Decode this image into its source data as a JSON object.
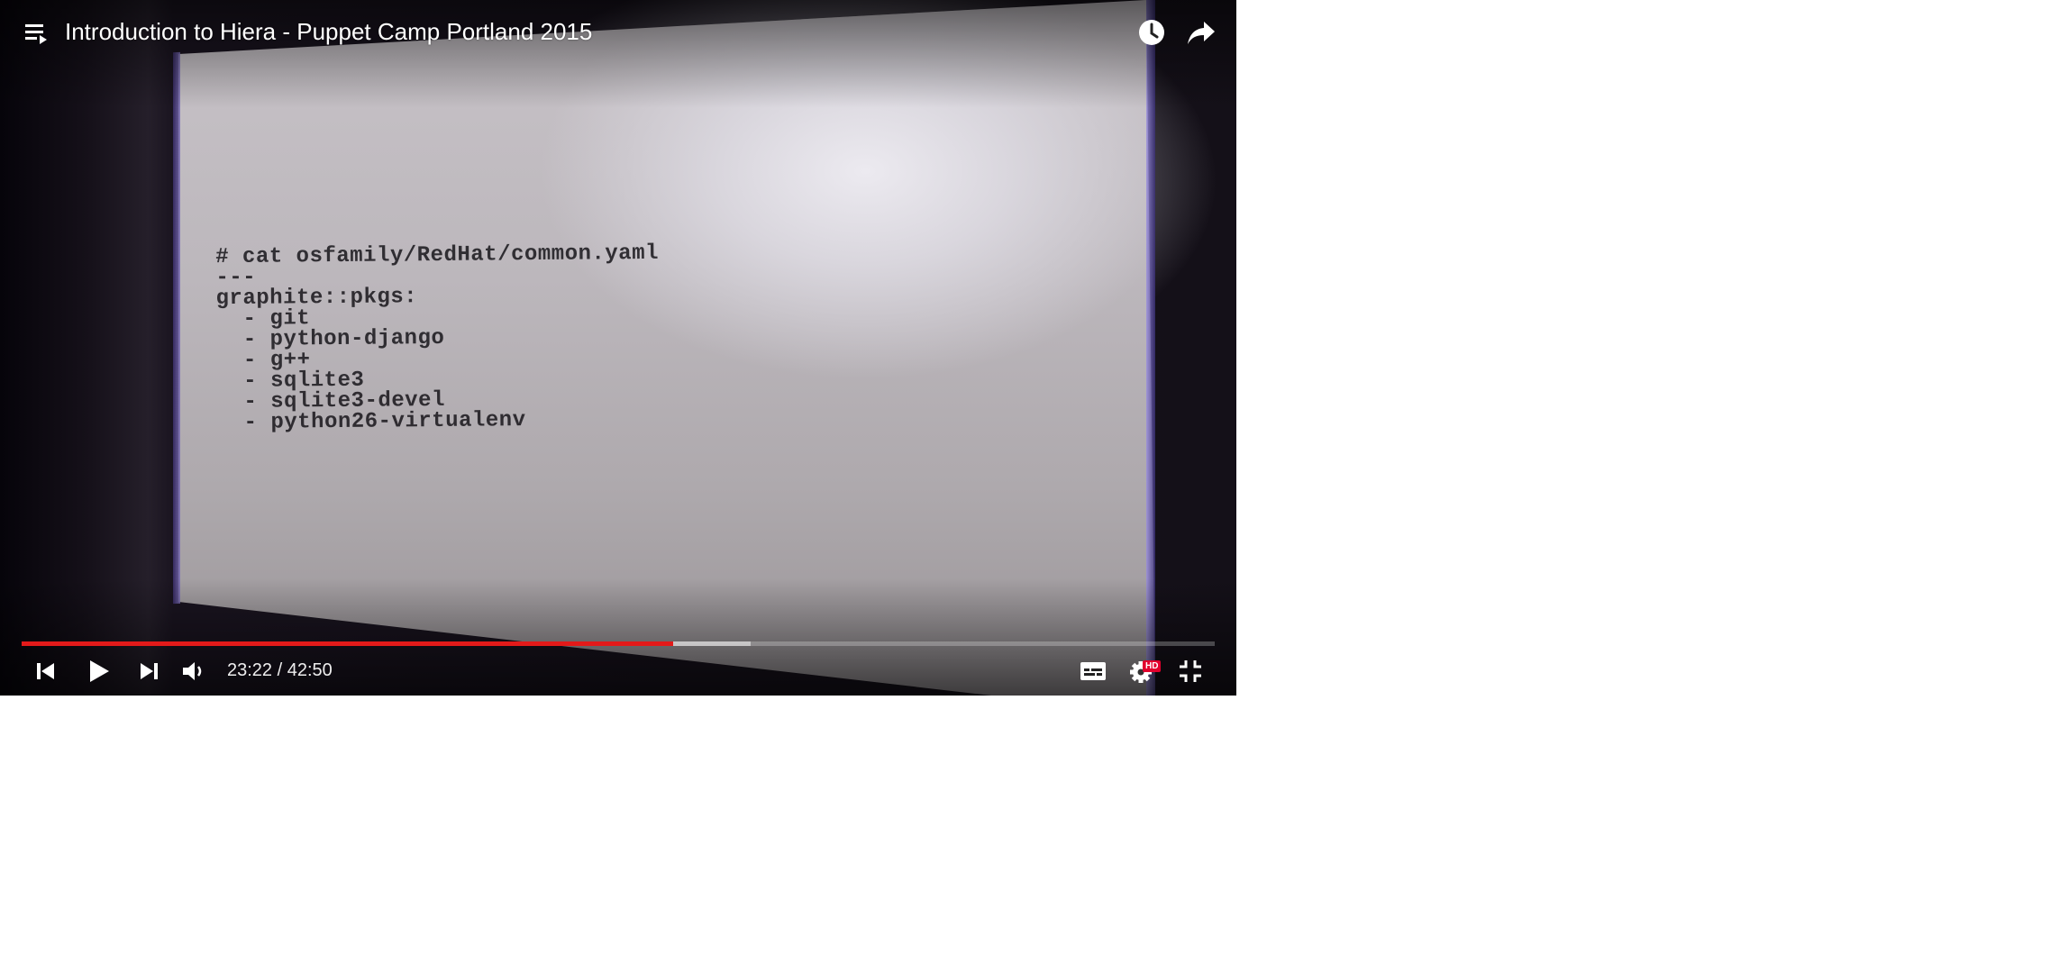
{
  "player": {
    "title": "Introduction to Hiera - Puppet Camp Portland 2015",
    "slide_text": "# cat osfamily/RedHat/common.yaml\n---\ngraphite::pkgs:\n  - git\n  - python-django\n  - g++\n  - sqlite3\n  - sqlite3-devel\n  - python26-virtualenv",
    "time": {
      "current": "23:22",
      "separator": " / ",
      "duration": "42:50"
    },
    "progress": {
      "played_fraction": 0.546,
      "buffered_fraction": 0.611
    },
    "quality_badge": "HD",
    "colors": {
      "progress_played": "#e21a1a",
      "hd_badge": "#e1002d"
    },
    "icons": {
      "playlist": "playlist-icon",
      "watch_later": "clock-icon",
      "share": "share-arrow-icon",
      "previous": "skip-previous-icon",
      "play": "play-icon",
      "next": "skip-next-icon",
      "volume": "volume-icon",
      "captions": "captions-icon",
      "settings": "gear-icon",
      "exit_fullscreen": "exit-fullscreen-icon"
    }
  }
}
